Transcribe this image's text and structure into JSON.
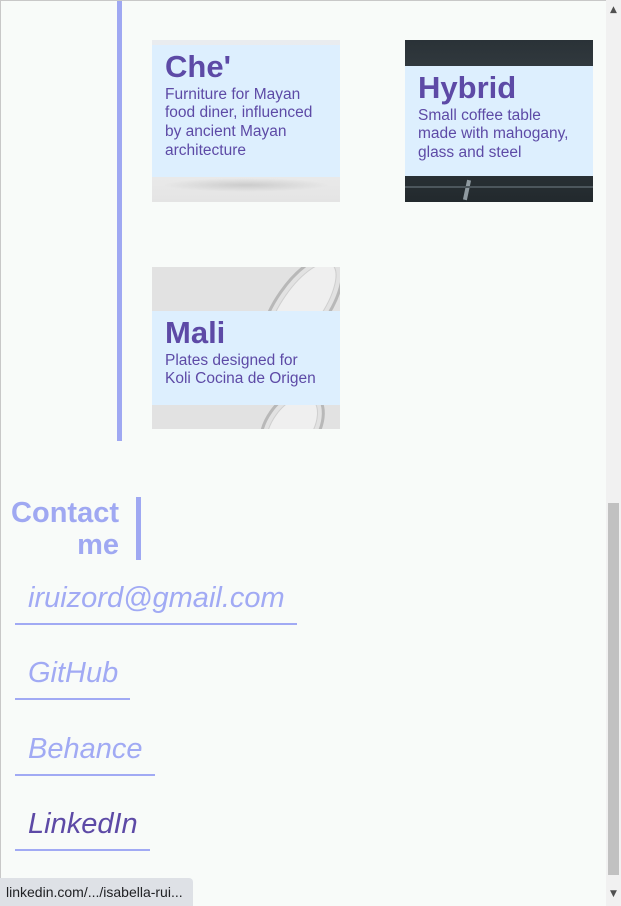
{
  "projects": [
    {
      "title": "Che'",
      "description": "Furniture for Mayan food diner, influenced by ancient Mayan architecture"
    },
    {
      "title": "Hybrid",
      "description": "Small coffee table made with mahogany, glass and steel"
    },
    {
      "title": "Mali",
      "description": "Plates designed for Koli Cocina de Origen"
    }
  ],
  "contact": {
    "heading": "Contact me",
    "links": [
      {
        "label": "iruizord@gmail.com"
      },
      {
        "label": "GitHub"
      },
      {
        "label": "Behance"
      },
      {
        "label": "LinkedIn"
      }
    ]
  },
  "status_bar": {
    "url": "linkedin.com/.../isabella-rui..."
  },
  "colors": {
    "accent": "#9fa8f2",
    "title_text": "#5d4aa6",
    "panel": "#ddeffe",
    "page_background": "#f8fbf9"
  },
  "icons": {
    "scroll_up": "triangle-up",
    "scroll_down": "triangle-down"
  }
}
